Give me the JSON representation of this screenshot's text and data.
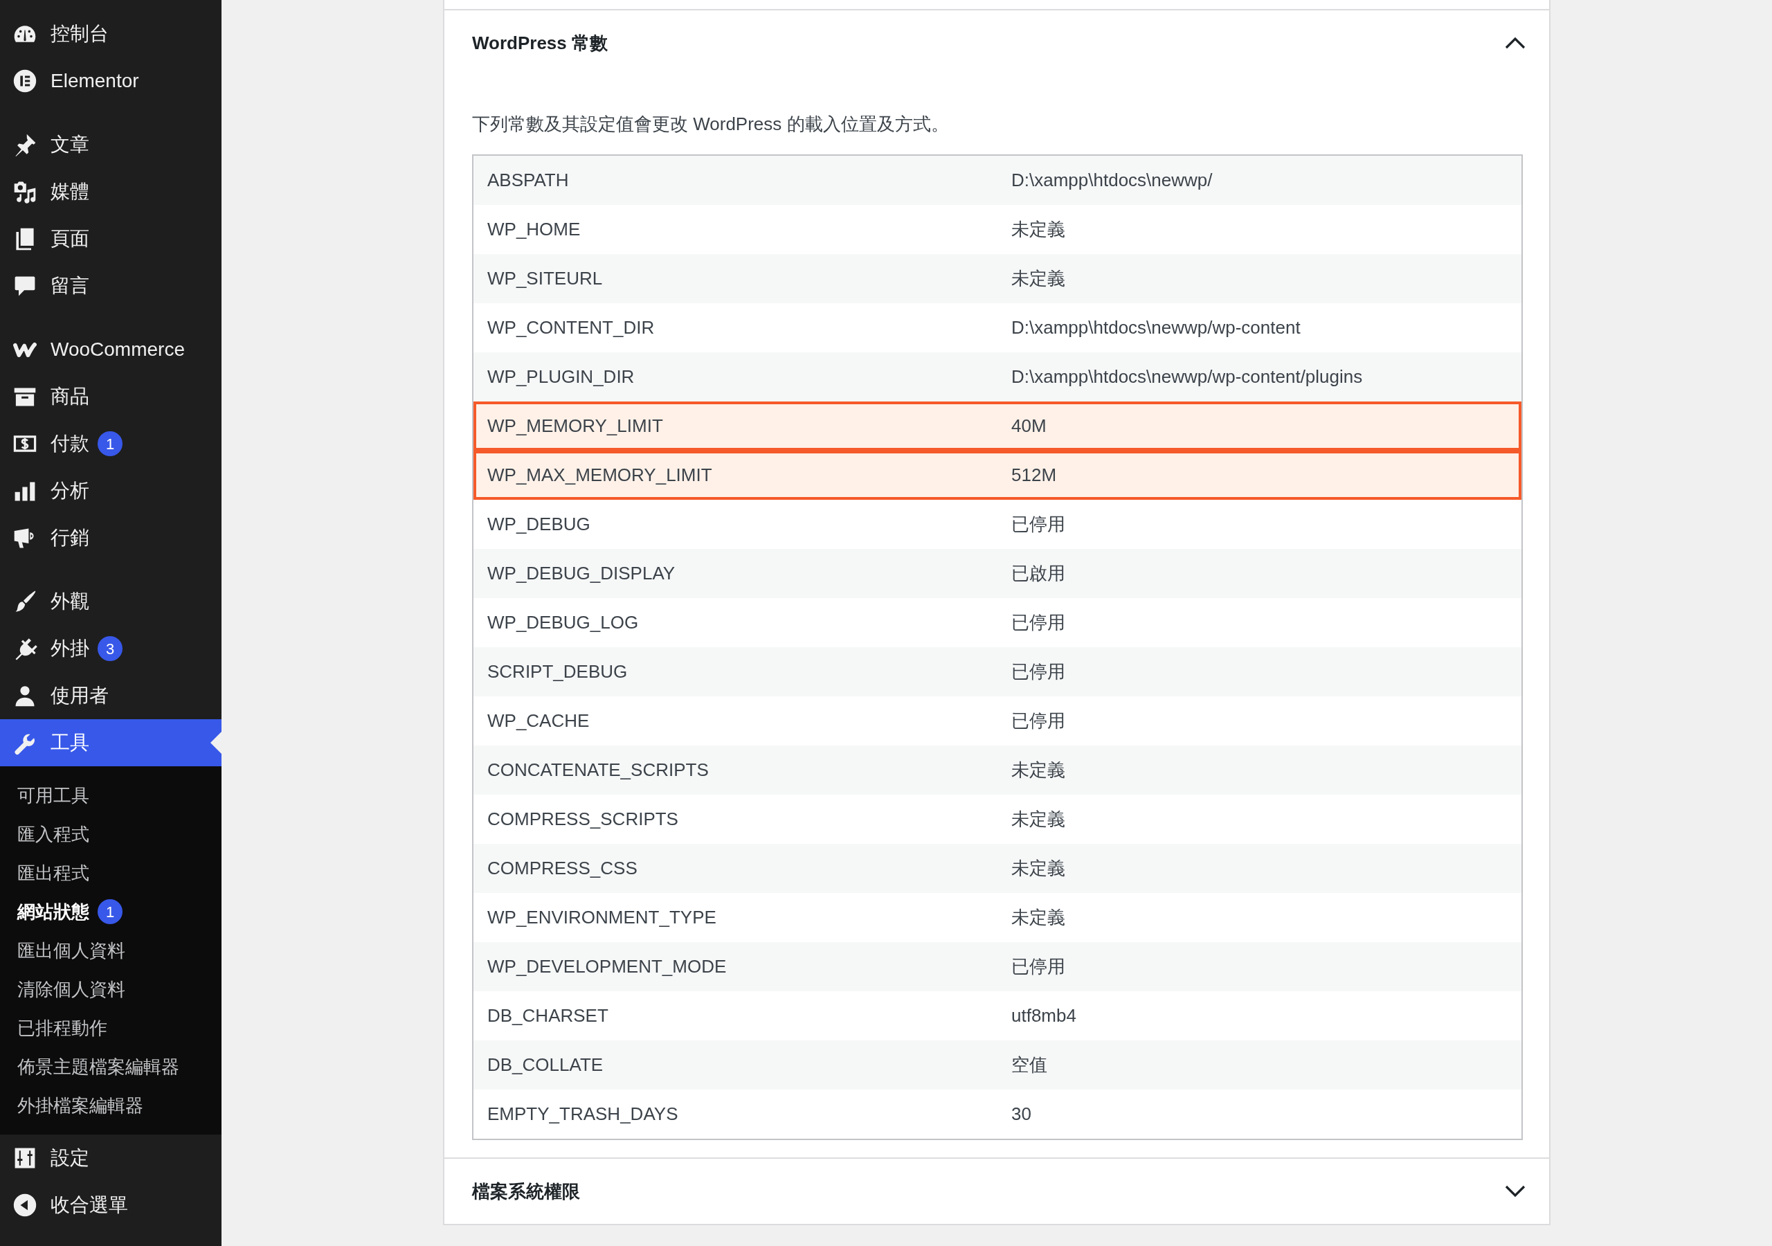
{
  "sidebar": {
    "groups": [
      {
        "items": [
          {
            "label": "控制台",
            "selected": false
          },
          {
            "label": "Elementor",
            "selected": false
          }
        ]
      },
      {
        "items": [
          {
            "label": "文章",
            "selected": false
          },
          {
            "label": "媒體",
            "selected": false
          },
          {
            "label": "頁面",
            "selected": false
          },
          {
            "label": "留言",
            "selected": false
          }
        ]
      },
      {
        "items": [
          {
            "label": "WooCommerce",
            "selected": false
          },
          {
            "label": "商品",
            "selected": false
          },
          {
            "label": "付款",
            "selected": false,
            "badge": "1"
          },
          {
            "label": "分析",
            "selected": false
          },
          {
            "label": "行銷",
            "selected": false
          }
        ]
      },
      {
        "items": [
          {
            "label": "外觀",
            "selected": false
          },
          {
            "label": "外掛",
            "selected": false,
            "badge": "3"
          },
          {
            "label": "使用者",
            "selected": false
          },
          {
            "label": "工具",
            "selected": true,
            "submenu": [
              {
                "label": "可用工具",
                "selected": false
              },
              {
                "label": "匯入程式",
                "selected": false
              },
              {
                "label": "匯出程式",
                "selected": false
              },
              {
                "label": "網站狀態",
                "selected": true,
                "badge": "1"
              },
              {
                "label": "匯出個人資料",
                "selected": false
              },
              {
                "label": "清除個人資料",
                "selected": false
              },
              {
                "label": "已排程動作",
                "selected": false
              },
              {
                "label": "佈景主題檔案編輯器",
                "selected": false
              },
              {
                "label": "外掛檔案編輯器",
                "selected": false
              }
            ]
          },
          {
            "label": "設定",
            "selected": false
          }
        ]
      }
    ],
    "collapse_button": {
      "label": "收合選單"
    }
  },
  "sections": [
    {
      "title": "WordPress 常數",
      "expanded": true,
      "description": "下列常數及其設定值會更改 WordPress 的載入位置及方式。",
      "rows": [
        {
          "name": "ABSPATH",
          "value": "D:\\xampp\\htdocs\\newwp/",
          "highlighted": false
        },
        {
          "name": "WP_HOME",
          "value": "未定義",
          "highlighted": false
        },
        {
          "name": "WP_SITEURL",
          "value": "未定義",
          "highlighted": false
        },
        {
          "name": "WP_CONTENT_DIR",
          "value": "D:\\xampp\\htdocs\\newwp/wp-content",
          "highlighted": false
        },
        {
          "name": "WP_PLUGIN_DIR",
          "value": "D:\\xampp\\htdocs\\newwp/wp-content/plugins",
          "highlighted": false
        },
        {
          "name": "WP_MEMORY_LIMIT",
          "value": "40M",
          "highlighted": true
        },
        {
          "name": "WP_MAX_MEMORY_LIMIT",
          "value": "512M",
          "highlighted": true
        },
        {
          "name": "WP_DEBUG",
          "value": "已停用",
          "highlighted": false
        },
        {
          "name": "WP_DEBUG_DISPLAY",
          "value": "已啟用",
          "highlighted": false
        },
        {
          "name": "WP_DEBUG_LOG",
          "value": "已停用",
          "highlighted": false
        },
        {
          "name": "SCRIPT_DEBUG",
          "value": "已停用",
          "highlighted": false
        },
        {
          "name": "WP_CACHE",
          "value": "已停用",
          "highlighted": false
        },
        {
          "name": "CONCATENATE_SCRIPTS",
          "value": "未定義",
          "highlighted": false
        },
        {
          "name": "COMPRESS_SCRIPTS",
          "value": "未定義",
          "highlighted": false
        },
        {
          "name": "COMPRESS_CSS",
          "value": "未定義",
          "highlighted": false
        },
        {
          "name": "WP_ENVIRONMENT_TYPE",
          "value": "未定義",
          "highlighted": false
        },
        {
          "name": "WP_DEVELOPMENT_MODE",
          "value": "已停用",
          "highlighted": false
        },
        {
          "name": "DB_CHARSET",
          "value": "utf8mb4",
          "highlighted": false
        },
        {
          "name": "DB_COLLATE",
          "value": "空值",
          "highlighted": false
        },
        {
          "name": "EMPTY_TRASH_DAYS",
          "value": "30",
          "highlighted": false
        }
      ]
    },
    {
      "title": "檔案系統權限",
      "expanded": false
    }
  ]
}
